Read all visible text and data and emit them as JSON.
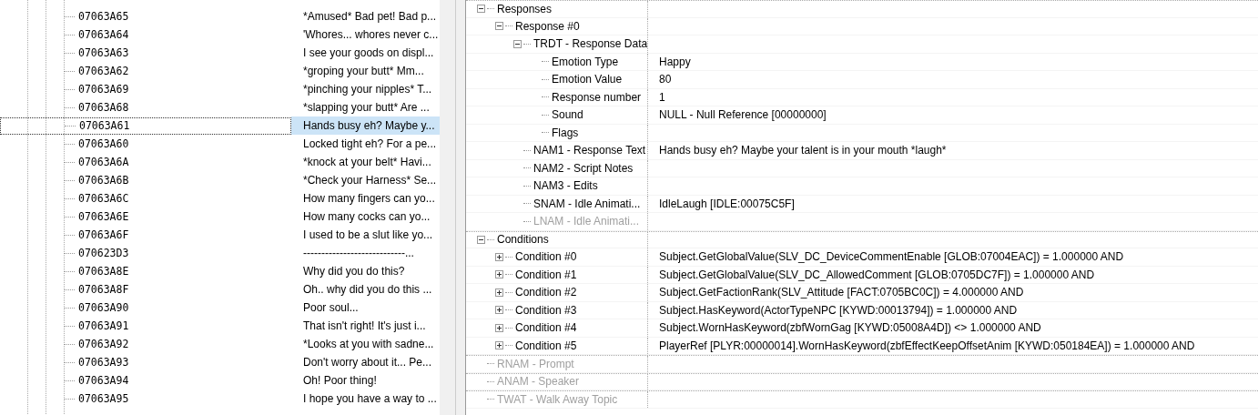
{
  "list": {
    "rows": [
      {
        "id": "07063A65",
        "text": "*Amused* Bad pet! Bad p...",
        "selected": false
      },
      {
        "id": "07063A64",
        "text": "'Whores... whores never c...",
        "selected": false
      },
      {
        "id": "07063A63",
        "text": "I see your goods on displ...",
        "selected": false
      },
      {
        "id": "07063A62",
        "text": "*groping your butt* Mm...",
        "selected": false
      },
      {
        "id": "07063A69",
        "text": "*pinching your nipples* T...",
        "selected": false
      },
      {
        "id": "07063A68",
        "text": "*slapping your butt* Are ...",
        "selected": false
      },
      {
        "id": "07063A61",
        "text": "Hands busy eh? Maybe y...",
        "selected": true
      },
      {
        "id": "07063A60",
        "text": "Locked tight eh? For a pe...",
        "selected": false
      },
      {
        "id": "07063A6A",
        "text": "*knock at your belt* Havi...",
        "selected": false
      },
      {
        "id": "07063A6B",
        "text": "*Check your Harness* Se...",
        "selected": false
      },
      {
        "id": "07063A6C",
        "text": "How many fingers can yo...",
        "selected": false
      },
      {
        "id": "07063A6E",
        "text": "How many cocks can yo...",
        "selected": false
      },
      {
        "id": "07063A6F",
        "text": "I used to be a slut like yo...",
        "selected": false
      },
      {
        "id": "070623D3",
        "text": "----------------------------...",
        "selected": false
      },
      {
        "id": "07063A8E",
        "text": "Why did you do this?",
        "selected": false
      },
      {
        "id": "07063A8F",
        "text": "Oh.. why did you do this ...",
        "selected": false
      },
      {
        "id": "07063A90",
        "text": "Poor soul...",
        "selected": false
      },
      {
        "id": "07063A91",
        "text": "That isn't right! It's just i...",
        "selected": false
      },
      {
        "id": "07063A92",
        "text": "*Looks at you with sadne...",
        "selected": false
      },
      {
        "id": "07063A93",
        "text": "Don't worry about it... Pe...",
        "selected": false
      },
      {
        "id": "07063A94",
        "text": "Oh! Poor thing!",
        "selected": false
      },
      {
        "id": "07063A95",
        "text": "I hope you have a way to ...",
        "selected": false
      }
    ]
  },
  "record": {
    "nodes": [
      {
        "label": "Responses",
        "expanded": true,
        "disabled": false,
        "children": [
          {
            "label": "Response #0",
            "expanded": true,
            "disabled": false,
            "children": [
              {
                "label": "TRDT - Response Data",
                "expanded": true,
                "disabled": false,
                "children": [
                  {
                    "label": "Emotion Type",
                    "value": "Happy",
                    "disabled": false
                  },
                  {
                    "label": "Emotion Value",
                    "value": "80",
                    "disabled": false
                  },
                  {
                    "label": "Response number",
                    "value": "1",
                    "disabled": false
                  },
                  {
                    "label": "Sound",
                    "value": "NULL - Null Reference [00000000]",
                    "disabled": false
                  },
                  {
                    "label": "Flags",
                    "disabled": false
                  }
                ]
              },
              {
                "label": "NAM1 - Response Text",
                "value": "Hands busy eh? Maybe your talent is in your mouth *laugh*",
                "disabled": false
              },
              {
                "label": "NAM2 - Script Notes",
                "disabled": false
              },
              {
                "label": "NAM3 - Edits",
                "disabled": false
              },
              {
                "label": "SNAM - Idle Animati...",
                "value": "IdleLaugh [IDLE:00075C5F]",
                "disabled": false
              },
              {
                "label": "LNAM - Idle Animati...",
                "disabled": true
              }
            ]
          }
        ]
      },
      {
        "label": "Conditions",
        "expanded": true,
        "disabled": false,
        "children": [
          {
            "label": "Condition #0",
            "expanded": false,
            "disabled": false,
            "value": "Subject.GetGlobalValue(SLV_DC_DeviceCommentEnable [GLOB:07004EAC]) = 1.000000 AND"
          },
          {
            "label": "Condition #1",
            "expanded": false,
            "disabled": false,
            "value": "Subject.GetGlobalValue(SLV_DC_AllowedComment [GLOB:0705DC7F]) = 1.000000 AND"
          },
          {
            "label": "Condition #2",
            "expanded": false,
            "disabled": false,
            "value": "Subject.GetFactionRank(SLV_Attitude [FACT:0705BC0C]) = 4.000000 AND"
          },
          {
            "label": "Condition #3",
            "expanded": false,
            "disabled": false,
            "value": "Subject.HasKeyword(ActorTypeNPC [KYWD:00013794]) = 1.000000 AND"
          },
          {
            "label": "Condition #4",
            "expanded": false,
            "disabled": false,
            "value": "Subject.WornHasKeyword(zbfWornGag [KYWD:05008A4D]) <> 1.000000 AND"
          },
          {
            "label": "Condition #5",
            "expanded": false,
            "disabled": false,
            "value": "PlayerRef [PLYR:00000014].WornHasKeyword(zbfEffectKeepOffsetAnim [KYWD:050184EA]) = 1.000000 AND"
          }
        ]
      },
      {
        "label": "RNAM - Prompt",
        "disabled": true
      },
      {
        "label": "ANAM - Speaker",
        "disabled": true
      },
      {
        "label": "TWAT - Walk Away Topic",
        "disabled": true
      }
    ]
  }
}
